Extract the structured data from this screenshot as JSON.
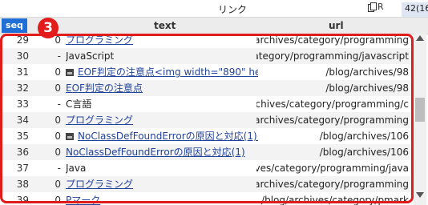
{
  "topbar": {
    "title": "リンク",
    "copy_label": "R",
    "count": "42(16)"
  },
  "header": {
    "seq": "seq",
    "text": "text",
    "url": "url"
  },
  "badge": "3",
  "rows": [
    {
      "seq": "29",
      "num": "0",
      "text": "プログラミング",
      "link": true,
      "img": false,
      "url": "g/archives/category/programming"
    },
    {
      "seq": "30",
      "num": "-",
      "text": "JavaScript",
      "link": false,
      "img": false,
      "url": "/category/programming/javascript"
    },
    {
      "seq": "31",
      "num": "0",
      "text": "EOF判定の注意点<img width=\"890\" heig...",
      "link": true,
      "img": true,
      "url": "/blog/archives/98"
    },
    {
      "seq": "32",
      "num": "0",
      "text": "EOF判定の注意点",
      "link": true,
      "img": false,
      "url": "/blog/archives/98"
    },
    {
      "seq": "33",
      "num": "-",
      "text": "C言語",
      "link": false,
      "img": false,
      "url": "archives/category/programming/c"
    },
    {
      "seq": "34",
      "num": "0",
      "text": "プログラミング",
      "link": true,
      "img": false,
      "url": "g/archives/category/programming"
    },
    {
      "seq": "35",
      "num": "0",
      "text": "NoClassDefFoundErrorの原因と対応(1)<i...",
      "link": true,
      "img": true,
      "url": "/blog/archives/106"
    },
    {
      "seq": "36",
      "num": "0",
      "text": "NoClassDefFoundErrorの原因と対応(1)",
      "link": true,
      "img": false,
      "url": "/blog/archives/106"
    },
    {
      "seq": "37",
      "num": "-",
      "text": "Java",
      "link": false,
      "img": false,
      "url": "hives/category/programming/java"
    },
    {
      "seq": "38",
      "num": "0",
      "text": "プログラミング",
      "link": true,
      "img": false,
      "url": "g/archives/category/programming"
    },
    {
      "seq": "39",
      "num": "0",
      "text": "Pマーク",
      "link": true,
      "img": false,
      "url": "/blog/archives/category/pmark"
    }
  ]
}
